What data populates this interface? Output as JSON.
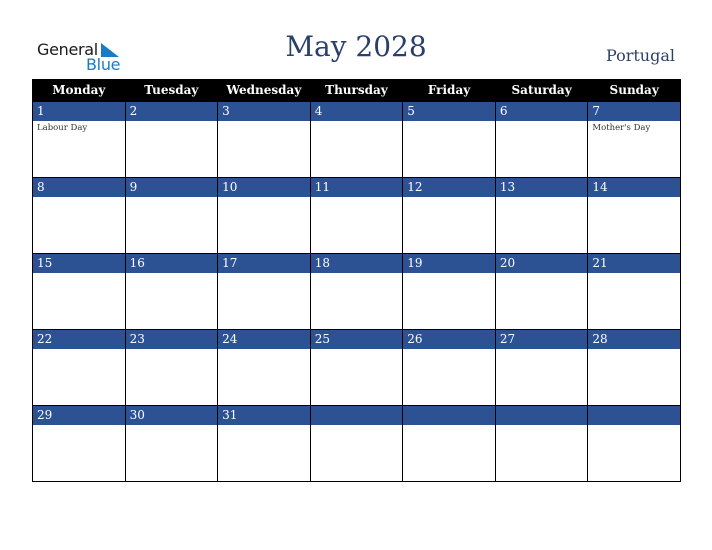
{
  "logo": {
    "line1": "General",
    "line2": "Blue"
  },
  "title": "May 2028",
  "country": "Portugal",
  "colors": {
    "header_bg": "#000000",
    "day_band": "#2d5294",
    "title": "#2b3f6b",
    "logo_blue": "#1a7bc4"
  },
  "weekdays": [
    "Monday",
    "Tuesday",
    "Wednesday",
    "Thursday",
    "Friday",
    "Saturday",
    "Sunday"
  ],
  "weeks": [
    [
      {
        "day": "1",
        "event": "Labour Day"
      },
      {
        "day": "2",
        "event": ""
      },
      {
        "day": "3",
        "event": ""
      },
      {
        "day": "4",
        "event": ""
      },
      {
        "day": "5",
        "event": ""
      },
      {
        "day": "6",
        "event": ""
      },
      {
        "day": "7",
        "event": "Mother's Day"
      }
    ],
    [
      {
        "day": "8",
        "event": ""
      },
      {
        "day": "9",
        "event": ""
      },
      {
        "day": "10",
        "event": ""
      },
      {
        "day": "11",
        "event": ""
      },
      {
        "day": "12",
        "event": ""
      },
      {
        "day": "13",
        "event": ""
      },
      {
        "day": "14",
        "event": ""
      }
    ],
    [
      {
        "day": "15",
        "event": ""
      },
      {
        "day": "16",
        "event": ""
      },
      {
        "day": "17",
        "event": ""
      },
      {
        "day": "18",
        "event": ""
      },
      {
        "day": "19",
        "event": ""
      },
      {
        "day": "20",
        "event": ""
      },
      {
        "day": "21",
        "event": ""
      }
    ],
    [
      {
        "day": "22",
        "event": ""
      },
      {
        "day": "23",
        "event": ""
      },
      {
        "day": "24",
        "event": ""
      },
      {
        "day": "25",
        "event": ""
      },
      {
        "day": "26",
        "event": ""
      },
      {
        "day": "27",
        "event": ""
      },
      {
        "day": "28",
        "event": ""
      }
    ],
    [
      {
        "day": "29",
        "event": ""
      },
      {
        "day": "30",
        "event": ""
      },
      {
        "day": "31",
        "event": ""
      },
      {
        "day": "",
        "event": ""
      },
      {
        "day": "",
        "event": ""
      },
      {
        "day": "",
        "event": ""
      },
      {
        "day": "",
        "event": ""
      }
    ]
  ]
}
